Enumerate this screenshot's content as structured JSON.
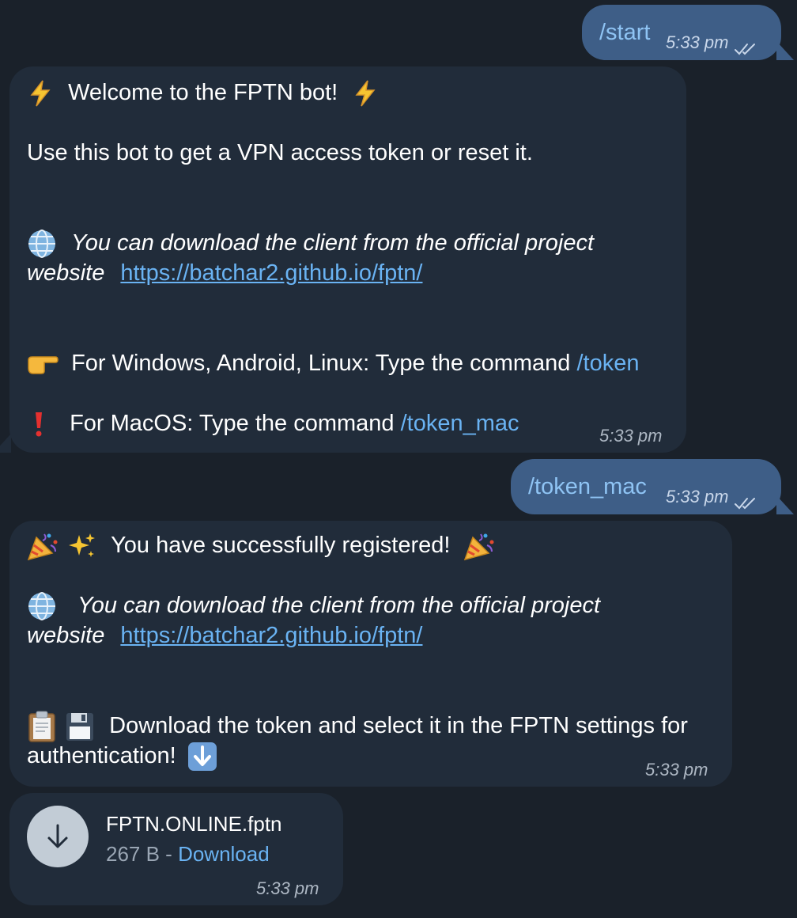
{
  "messages": {
    "m1": {
      "text": "/start",
      "time": "5:33 pm"
    },
    "m2": {
      "line1": "Welcome to the FPTN bot!",
      "line2": "Use this bot to get a VPN access token or reset it.",
      "line3a": "You can download the client from the official project",
      "line3b": "website",
      "link": "https://batchar2.github.io/fptn/",
      "line4": "For Windows, Android, Linux: Type the command ",
      "cmd_token": "/token",
      "line5": "For MacOS: Type the command ",
      "cmd_token_mac": "/token_mac",
      "time": "5:33 pm"
    },
    "m3": {
      "text": "/token_mac",
      "time": "5:33 pm"
    },
    "m4": {
      "line1": "You have successfully registered!",
      "line2a": "You can download the client from the official project",
      "line2b": "website",
      "link": "https://batchar2.github.io/fptn/",
      "line3a": "Download the token and select it in the FPTN settings for",
      "line3b": "authentication!",
      "time": "5:33 pm"
    },
    "m5": {
      "file_name": "FPTN.ONLINE.fptn",
      "file_size": "267 B",
      "separator": " - ",
      "download_label": "Download",
      "time": "5:33 pm"
    }
  },
  "icons": {
    "lightning": "lightning-emoji-icon",
    "globe": "globe-emoji-icon",
    "pointing": "pointing-right-emoji-icon",
    "exclamation": "red-exclamation-emoji-icon",
    "party": "party-popper-emoji-icon",
    "sparkles": "sparkles-emoji-icon",
    "clipboard": "clipboard-emoji-icon",
    "floppy": "floppy-disk-emoji-icon",
    "down_arrow": "down-arrow-button-emoji-icon",
    "download": "download-arrow-icon",
    "read_check": "double-check-icon"
  },
  "colors": {
    "background": "#1a212a",
    "incoming_bubble": "#212c3a",
    "outgoing_bubble": "#3e5e87",
    "link": "#6ab3f3"
  }
}
